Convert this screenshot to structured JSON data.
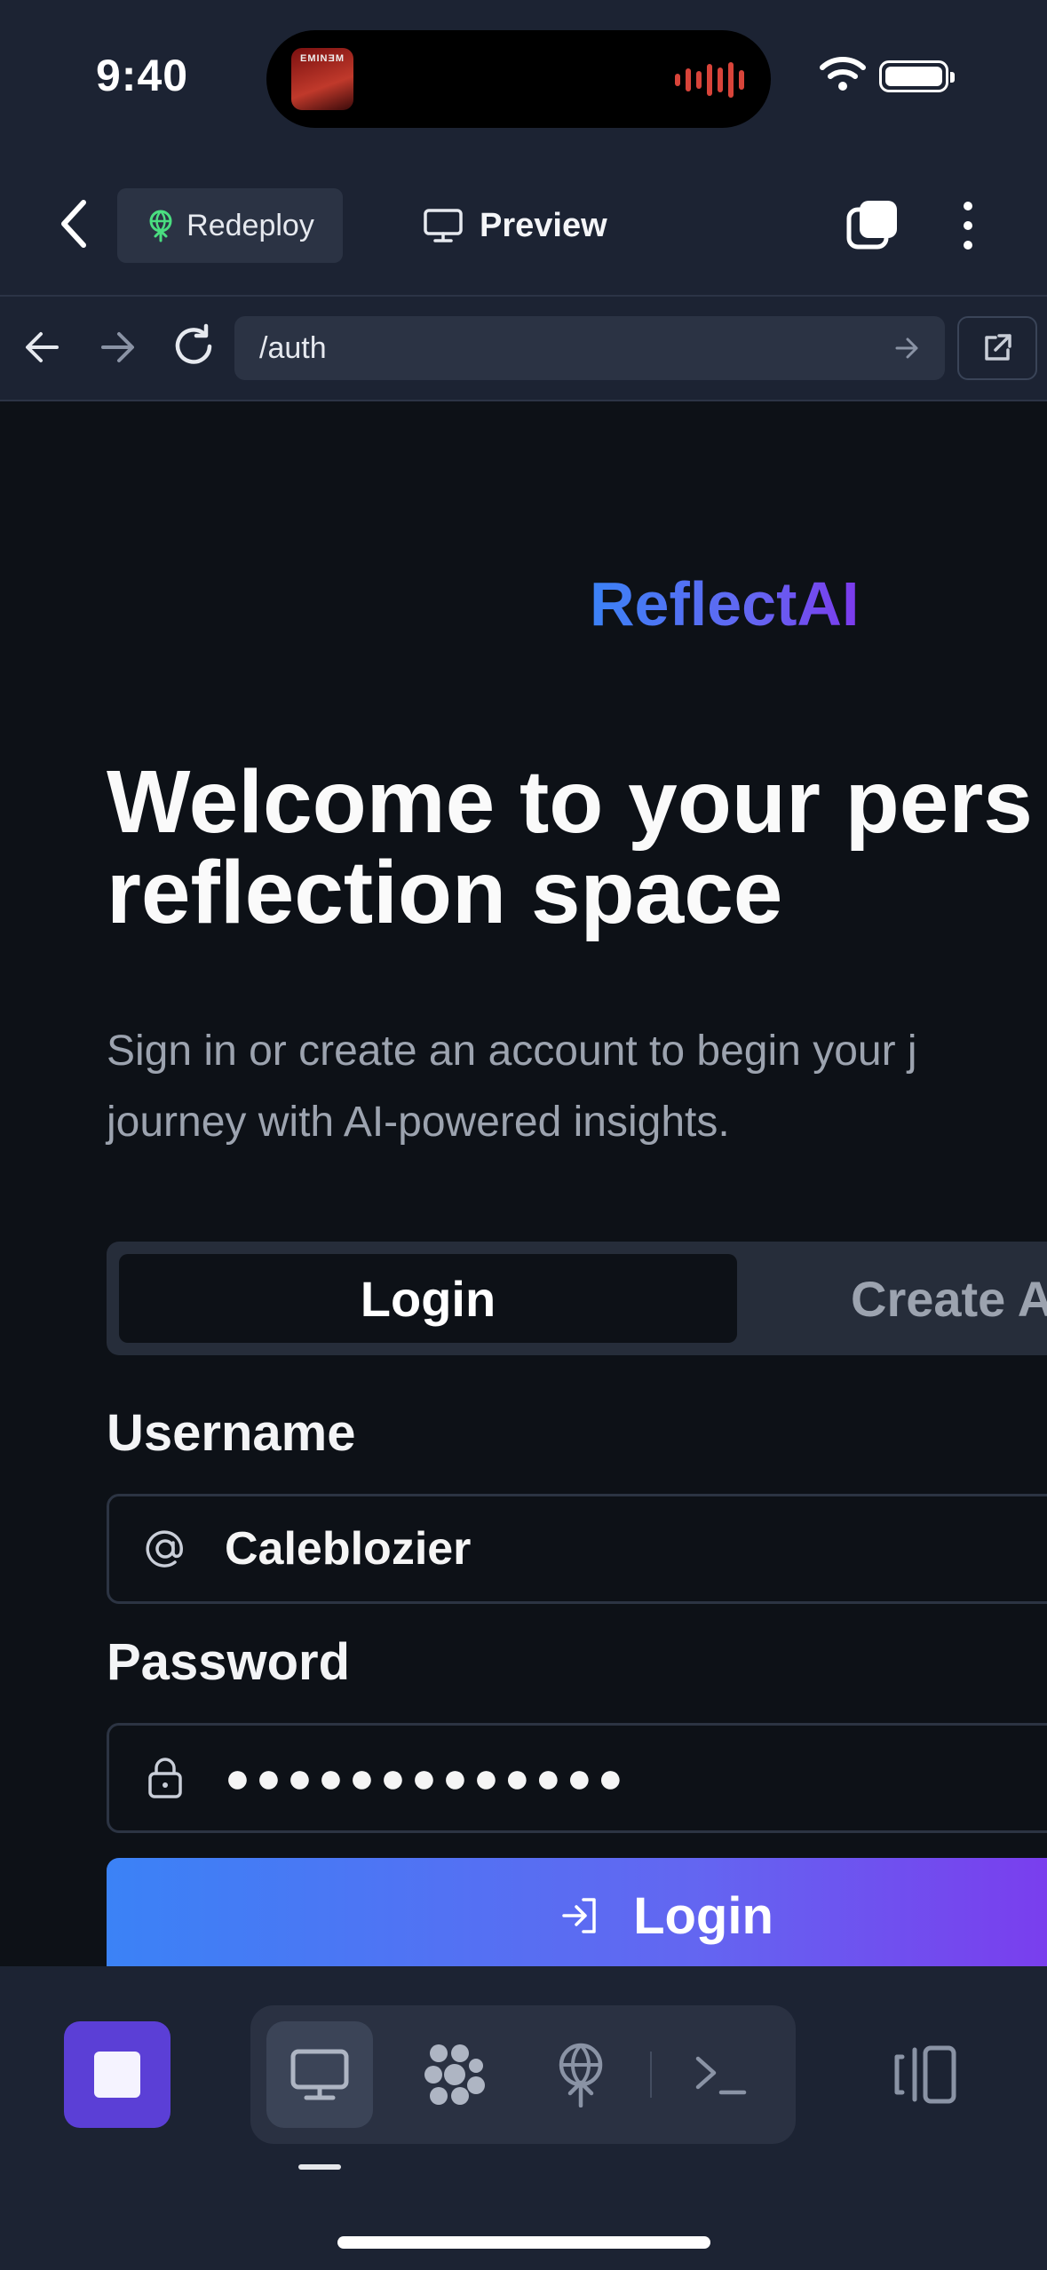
{
  "status_bar": {
    "time": "9:40",
    "now_playing_art_text": "EMINƎM"
  },
  "header": {
    "redeploy_label": "Redeploy",
    "preview_label": "Preview"
  },
  "browser": {
    "url": "/auth"
  },
  "brand": {
    "name": "ReflectAI",
    "gradient_colors": [
      "#3b82f6",
      "#7c3aed"
    ]
  },
  "hero": {
    "headline_line1": "Welcome to your pers",
    "headline_line2": "reflection space",
    "subtext_line1": "Sign in or create an account to begin your j",
    "subtext_line2": "journey with AI-powered insights."
  },
  "auth_tabs": {
    "login": "Login",
    "create": "Create A"
  },
  "form": {
    "username_label": "Username",
    "username_value": "Calebl​ozier",
    "password_label": "Password",
    "password_value": "●●●●●●●●●●●●●",
    "submit_label": "Login"
  },
  "toolbar": {
    "icons": [
      "stop-icon",
      "desktop-icon",
      "nodes-icon",
      "deploy-icon",
      "terminal-icon",
      "panel-toggle-icon"
    ],
    "accent": "#5b3fd6"
  }
}
